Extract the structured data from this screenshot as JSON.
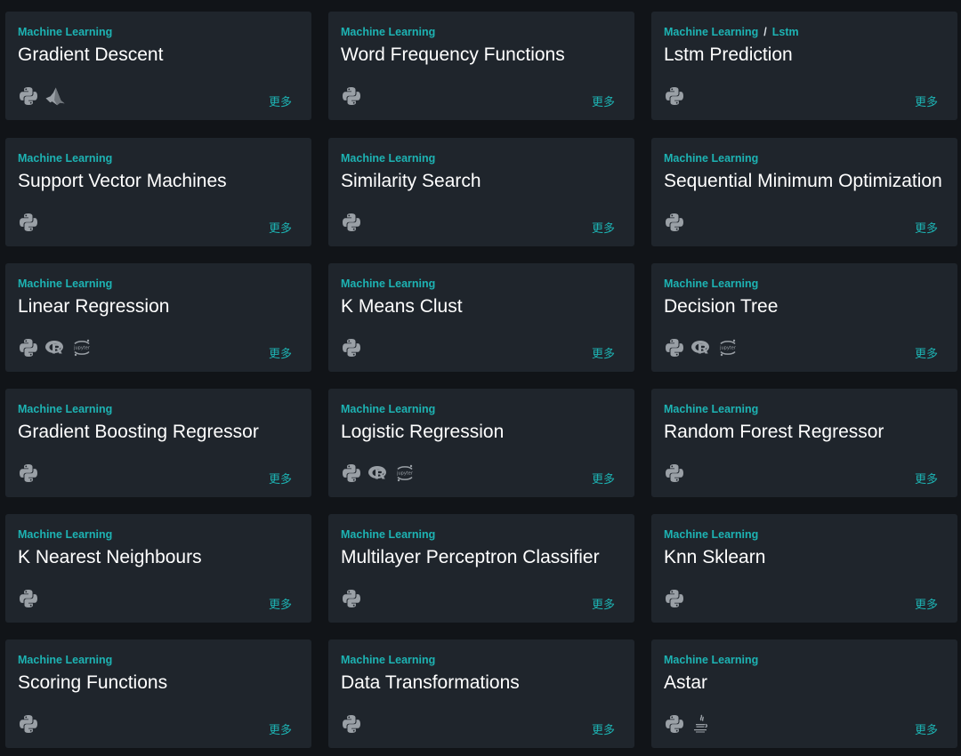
{
  "more_label": "更多",
  "colors": {
    "background": "#111418",
    "card": "#1f252c",
    "accent": "#1db3b3",
    "title": "#ffffff",
    "icon": "#9aa0a6"
  },
  "cards": [
    {
      "category": "Machine Learning",
      "subcategory": "",
      "title": "Gradient Descent",
      "icons": [
        "python-icon",
        "matlab-icon"
      ]
    },
    {
      "category": "Machine Learning",
      "subcategory": "",
      "title": "Word Frequency Functions",
      "icons": [
        "python-icon"
      ]
    },
    {
      "category": "Machine Learning",
      "subcategory": "Lstm",
      "title": "Lstm Prediction",
      "icons": [
        "python-icon"
      ]
    },
    {
      "category": "Machine Learning",
      "subcategory": "",
      "title": "Support Vector Machines",
      "icons": [
        "python-icon"
      ]
    },
    {
      "category": "Machine Learning",
      "subcategory": "",
      "title": "Similarity Search",
      "icons": [
        "python-icon"
      ]
    },
    {
      "category": "Machine Learning",
      "subcategory": "",
      "title": "Sequential Minimum Optimization",
      "icons": [
        "python-icon"
      ]
    },
    {
      "category": "Machine Learning",
      "subcategory": "",
      "title": "Linear Regression",
      "icons": [
        "python-icon",
        "r-icon",
        "jupyter-icon"
      ]
    },
    {
      "category": "Machine Learning",
      "subcategory": "",
      "title": "K Means Clust",
      "icons": [
        "python-icon"
      ]
    },
    {
      "category": "Machine Learning",
      "subcategory": "",
      "title": "Decision Tree",
      "icons": [
        "python-icon",
        "r-icon",
        "jupyter-icon"
      ]
    },
    {
      "category": "Machine Learning",
      "subcategory": "",
      "title": "Gradient Boosting Regressor",
      "icons": [
        "python-icon"
      ]
    },
    {
      "category": "Machine Learning",
      "subcategory": "",
      "title": "Logistic Regression",
      "icons": [
        "python-icon",
        "r-icon",
        "jupyter-icon"
      ]
    },
    {
      "category": "Machine Learning",
      "subcategory": "",
      "title": "Random Forest Regressor",
      "icons": [
        "python-icon"
      ]
    },
    {
      "category": "Machine Learning",
      "subcategory": "",
      "title": "K Nearest Neighbours",
      "icons": [
        "python-icon"
      ]
    },
    {
      "category": "Machine Learning",
      "subcategory": "",
      "title": "Multilayer Perceptron Classifier",
      "icons": [
        "python-icon"
      ]
    },
    {
      "category": "Machine Learning",
      "subcategory": "",
      "title": "Knn Sklearn",
      "icons": [
        "python-icon"
      ]
    },
    {
      "category": "Machine Learning",
      "subcategory": "",
      "title": "Scoring Functions",
      "icons": [
        "python-icon"
      ]
    },
    {
      "category": "Machine Learning",
      "subcategory": "",
      "title": "Data Transformations",
      "icons": [
        "python-icon"
      ]
    },
    {
      "category": "Machine Learning",
      "subcategory": "",
      "title": "Astar",
      "icons": [
        "python-icon",
        "java-icon"
      ]
    }
  ]
}
